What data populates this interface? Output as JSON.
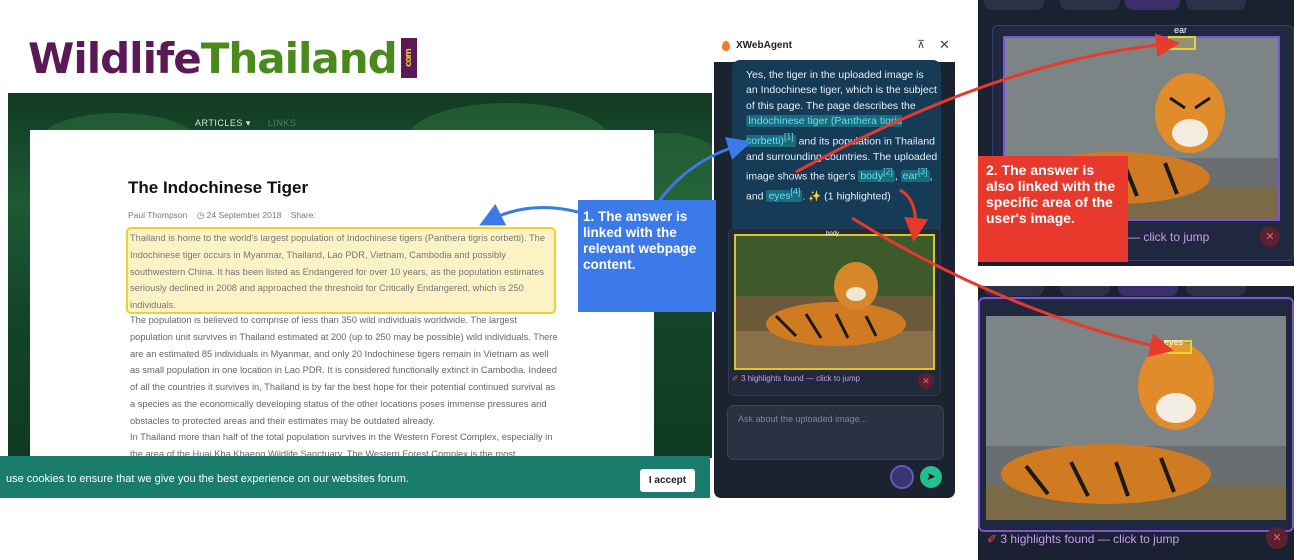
{
  "site": {
    "logo_part1": "Wildlife",
    "logo_part2": "Thailand",
    "logo_com": "com",
    "nav": "ARTICLES ▾",
    "nav_dim": "LINKS",
    "article_title": "The Indochinese Tiger",
    "author": "Paul Thompson",
    "date": "24 September 2018",
    "share": "Share:",
    "para1": "Thailand is home to the world's largest population of Indochinese tigers (Panthera tigris corbetti). The Indochinese tiger occurs in Myanmar, Thailand, Lao PDR, Vietnam, Cambodia and possibly southwestern China. It has been listed as Endangered for over 10 years, as the population estimates seriously declined in 2008 and approached the threshold for Critically Endangered, which is 250 individuals.",
    "para2": "The population is believed to comprise of less than 350 wild individuals worldwide. The largest population unit survives in Thailand estimated at 200 (up to 250 may be possible) wild individuals. There are an estimated 85 individuals in Myanmar, and only 20 Indochinese tigers remain in Vietnam as well as small population in one location in Lao PDR. It is considered functionally extinct in Cambodia. Indeed of all the countries it survives in, Thailand is by far the best hope for their potential continued survival as a species as the economically developing status of the other locations poses immense pressures and obstacles to protected areas and their estimates may be outdated already.",
    "para3": "In Thailand more than half of the total population survives in the Western Forest Complex, especially in the area of the Huai Kha Khaeng Wildlife Sanctuary. The Western Forest Complex is the most",
    "cookie_text": "use cookies to ensure that we give you the best experience on our websites forum.",
    "accept": "I accept"
  },
  "callouts": {
    "c1": "1. The answer  is linked with the relevant webpage content.",
    "c2": "2. The answer is also linked with the specific area of the user's image."
  },
  "panel": {
    "title": "XWebAgent",
    "pin_icon": "pin-off-icon",
    "answer_a": "Yes, the tiger in the uploaded image is an Indochinese tiger, which is the subject of this page. The page describes the ",
    "chip1": "Indochinese tiger (Panthera tigris corbetti)",
    "sup1": "[1]",
    "answer_b": " and its population in Thailand and surrounding countries. The uploaded image shows the tiger's ",
    "chip2": "body",
    "sup2": "[2]",
    "answer_c": ", ",
    "chip3": "ear",
    "sup3": "[3]",
    "answer_d": ", and ",
    "chip4": "eyes",
    "sup4": "[4]",
    "answer_e": ". ✨ (1 highlighted)",
    "image_label": "body",
    "highlights": "3 highlights found — click to jump",
    "ask_placeholder": "Ask about the uploaded image..."
  },
  "right": {
    "ear_label": "ear",
    "jump_text": "— click to jump",
    "eyes_label": "eyes",
    "highlights": "3 highlights found — click to jump"
  },
  "colors": {
    "accent_blue": "#3b7ae8",
    "accent_red": "#e8392c",
    "highlight_yellow": "#f1d02e"
  }
}
